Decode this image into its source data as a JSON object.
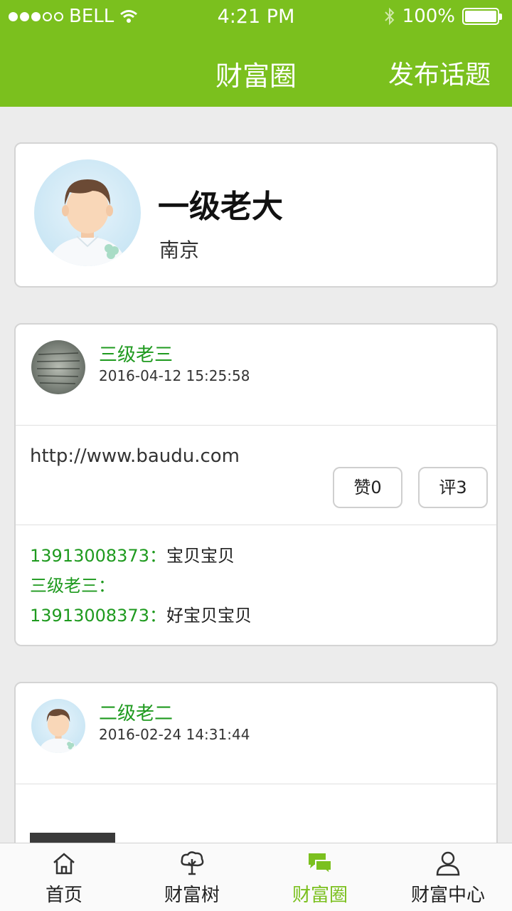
{
  "status_bar": {
    "carrier": "BELL",
    "time": "4:21 PM",
    "battery": "100%"
  },
  "header": {
    "title": "财富圈",
    "publish_label": "发布话题"
  },
  "profile": {
    "name": "一级老大",
    "city": "南京"
  },
  "posts": [
    {
      "author": "三级老三",
      "time": "2016-04-12 15:25:58",
      "text": "http://www.baudu.com",
      "like_label": "赞0",
      "comment_label": "评3",
      "comments": [
        {
          "user": "13913008373：",
          "text": "宝贝宝贝"
        },
        {
          "user": "三级老三：",
          "text": ""
        },
        {
          "user": "13913008373：",
          "text": "好宝贝宝贝"
        }
      ]
    },
    {
      "author": "二级老二",
      "time": "2016-02-24 14:31:44"
    }
  ],
  "bottom_nav": {
    "items": [
      {
        "label": "首页",
        "icon": "home-icon"
      },
      {
        "label": "财富树",
        "icon": "tree-icon"
      },
      {
        "label": "财富圈",
        "icon": "chat-bubbles-icon",
        "active": true
      },
      {
        "label": "财富中心",
        "icon": "user-icon"
      }
    ]
  },
  "colors": {
    "brand_green": "#7bc01e",
    "author_green": "#1f9a1f",
    "background": "#ececec"
  }
}
